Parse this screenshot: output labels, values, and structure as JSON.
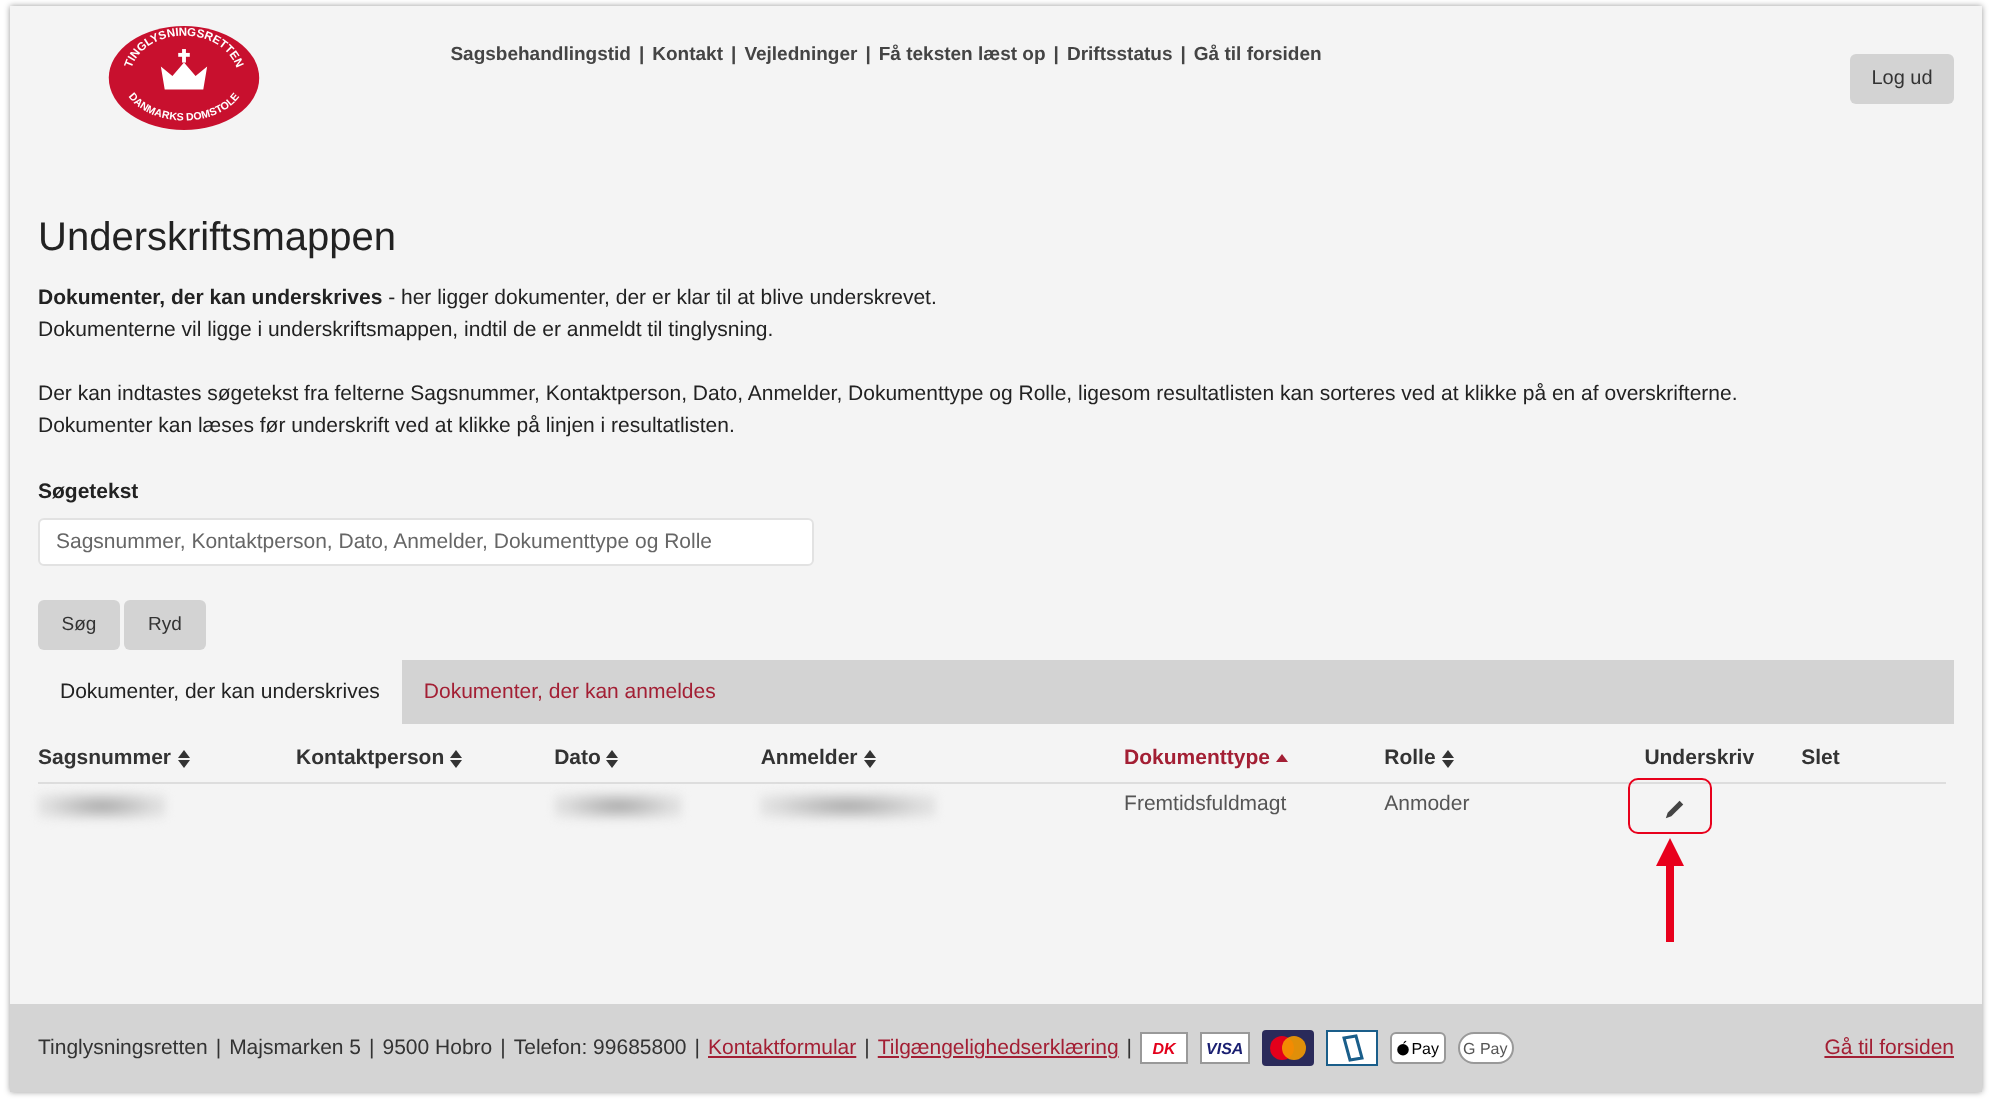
{
  "logo": {
    "top_text": "TINGLYSNINGSRETTEN",
    "bottom_text": "DANMARKS DOMSTOLE"
  },
  "separator": "|",
  "top_links": [
    "Sagsbehandlingstid",
    "Kontakt",
    "Vejledninger",
    "Få teksten læst op",
    "Driftsstatus",
    "Gå til forsiden"
  ],
  "logout_button": "Log ud",
  "title": "Underskriftsmappen",
  "intro": [
    "**Dokumenter, der kan underskrives** - her ligger dokumenter, der er klar til at blive underskrevet.",
    "Dokumenterne vil ligge i underskriftsmappen, indtil de er anmeldt til tinglysning."
  ],
  "help": [
    "Der kan indtastes søgetekst fra felterne Sagsnummer, Kontaktperson, Dato, Anmelder, Dokumenttype og Rolle, ligesom resultatlisten kan sorteres ved at klikke på en af overskrifterne.",
    "Dokumenter kan læses før underskrift ved at klikke på linjen i resultatlisten."
  ],
  "search": {
    "label": "Søgetekst",
    "placeholder": "Sagsnummer, Kontaktperson, Dato, Anmelder, Dokumenttype og Rolle"
  },
  "buttons": [
    "Søg",
    "Ryd"
  ],
  "tabs": [
    {
      "label": "Dokumenter, der kan underskrives",
      "selected": true
    },
    {
      "label": "Dokumenter, der kan anmeldes",
      "selected": false
    }
  ],
  "table": {
    "columns": [
      {
        "label": "Sagsnummer",
        "sortable": true,
        "sorted": false
      },
      {
        "label": "Kontaktperson",
        "sortable": true,
        "sorted": false
      },
      {
        "label": "Dato",
        "sortable": true,
        "sorted": false
      },
      {
        "label": "Anmelder",
        "sortable": true,
        "sorted": false
      },
      {
        "label": "Dokumenttype",
        "sortable": true,
        "sorted": true
      },
      {
        "label": "Rolle",
        "sortable": true,
        "sorted": false
      },
      {
        "label": "Underskriv",
        "sortable": false,
        "sorted": false
      },
      {
        "label": "Slet",
        "sortable": false,
        "sorted": false
      }
    ],
    "rows": [
      {
        "cells": [
          {
            "kind": "redacted"
          },
          {
            "kind": "empty"
          },
          {
            "kind": "redacted"
          },
          {
            "kind": "redacted"
          },
          {
            "kind": "text",
            "text": "Fremtidsfuldmagt"
          },
          {
            "kind": "text",
            "text": "Anmoder"
          },
          {
            "kind": "sign"
          },
          {
            "kind": "empty"
          }
        ],
        "highlighted": true
      }
    ]
  },
  "footer": {
    "parts": [
      {
        "kind": "text",
        "text": "Tinglysningsretten"
      },
      {
        "kind": "text",
        "text": "Majsmarken 5"
      },
      {
        "kind": "text",
        "text": "9500 Hobro"
      },
      {
        "kind": "text",
        "text": "Telefon: 99685800"
      },
      {
        "kind": "link",
        "text": "Kontaktformular"
      },
      {
        "kind": "link",
        "text": "Tilgængelighedserklæring"
      }
    ],
    "payments": [
      {
        "kind": "dankort",
        "label": "DK"
      },
      {
        "kind": "visa",
        "label": "VISA"
      },
      {
        "kind": "mastercard"
      },
      {
        "kind": "mobilepay"
      },
      {
        "kind": "applepay",
        "label": "Pay"
      },
      {
        "kind": "googlepay",
        "label": "G Pay"
      }
    ],
    "home_link": "Gå til forsiden"
  }
}
